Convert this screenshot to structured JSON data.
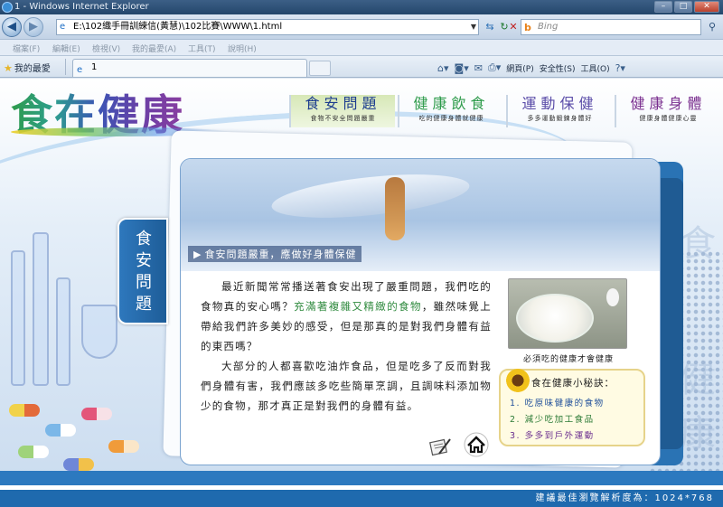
{
  "browser": {
    "window_title": "1 - Windows Internet Explorer",
    "address": "E:\\102織手冊訓練信(黃慧)\\102比賽\\WWW\\1.html",
    "search_placeholder": "Bing",
    "menu": [
      "檔案(F)",
      "編輯(E)",
      "檢視(V)",
      "我的最愛(A)",
      "工具(T)",
      "說明(H)"
    ],
    "favorites_label": "我的最愛",
    "tab_title": "1",
    "commands": {
      "page": "網頁(P)",
      "safety": "安全性(S)",
      "tools": "工具(O)"
    }
  },
  "site": {
    "logo_text": "食在健康",
    "nav": [
      {
        "title": "食安問題",
        "subtitle": "食物不安全問題嚴重"
      },
      {
        "title": "健康飲食",
        "subtitle": "吃的健康身體就健康"
      },
      {
        "title": "運動保健",
        "subtitle": "多多運動鍛鍊身體好"
      },
      {
        "title": "健康身體",
        "subtitle": "健康身體健康心靈"
      }
    ],
    "side_tab": "食安問題",
    "banner_caption": "食安問題嚴重，應做好身體保健",
    "paragraphs": [
      {
        "a": "最近新聞常常播送著食安出現了嚴重問題，我們吃的食物真的安心嗎？",
        "b": "充滿著複雜又精緻的食物",
        "c": "，雖然味覺上帶給我們許多美妙的感受，但是那真的是對我們身體有益的東西嗎？"
      },
      {
        "a": "大部分的人都喜歡吃油炸食品，但是吃多了反而對我們身體有害，我們應該多吃些簡單烹調，且調味料添加物少的食物，那才真正是對我們的身體有益。",
        "b": "",
        "c": ""
      }
    ],
    "photo_caption": "必須吃的健康才會健康",
    "tips_title": "食在健康小秘訣：",
    "tips": [
      "1. 吃原味健康的食物",
      "2. 減少吃加工食品",
      "3. 多多到戶外運動"
    ],
    "footer": "建議最佳瀏覽解析度為：1024*768",
    "bg_chars": [
      "食",
      "健",
      "康"
    ]
  }
}
